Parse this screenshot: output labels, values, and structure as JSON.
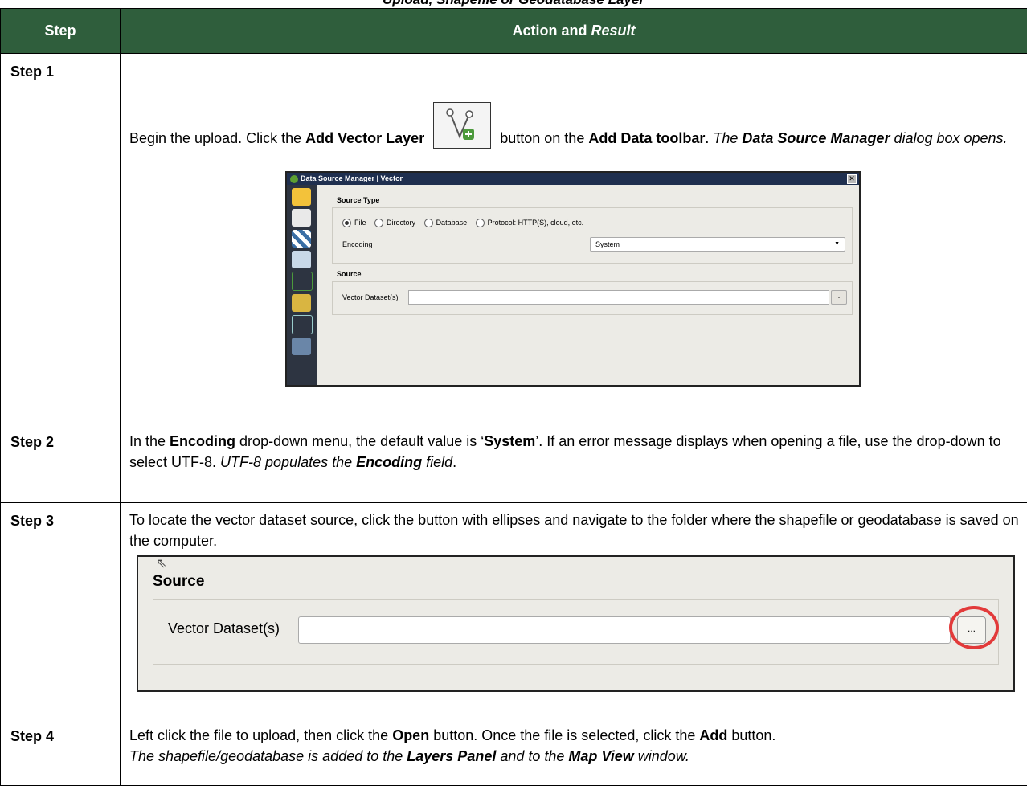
{
  "caption": "Upload, Shapefile or Geodatabase Layer",
  "table": {
    "header": {
      "step": "Step",
      "action": "Action and ",
      "result": "Result"
    },
    "rows": [
      {
        "step": "Step 1",
        "p1a": "Begin the upload. Click the ",
        "p1b": "Add Vector Layer",
        "p1c": " button on the ",
        "p1d": "Add Data toolbar",
        "p1e": ". ",
        "p1f": "The ",
        "p1g": "Data Source Manager",
        "p1h": " dialog box opens."
      },
      {
        "step": "Step 2",
        "a": "In the ",
        "b": "Encoding",
        "c": " drop-down menu, the default value is ‘",
        "d": "System",
        "e": "’. If an error message displays when opening a file, use the drop-down to select UTF-8. ",
        "f": "UTF-8 populates the ",
        "g": "Encoding",
        "h": " field",
        "i": "."
      },
      {
        "step": "Step 3",
        "text": "To locate the vector dataset source, click the button with ellipses and navigate to the folder where the shapefile or geodatabase is saved on the computer."
      },
      {
        "step": "Step 4",
        "a": "Left click the file to upload, then click the ",
        "b": "Open",
        "c": " button. Once the file is selected, click the ",
        "d": "Add",
        "e": " button.",
        "f": "The shapefile/geodatabase is added to the ",
        "g": "Layers Panel",
        "h": " and to the ",
        "i": "Map View",
        "j": " window."
      }
    ]
  },
  "dialog": {
    "title": "Data Source Manager | Vector",
    "close": "✕",
    "source_type_heading": "Source Type",
    "radios": [
      "File",
      "Directory",
      "Database",
      "Protocol: HTTP(S), cloud, etc."
    ],
    "selected_radio": "File",
    "encoding_label": "Encoding",
    "encoding_value": "System",
    "source_heading": "Source",
    "dataset_label": "Vector Dataset(s)",
    "browse": "..."
  },
  "zoom_panel": {
    "heading": "Source",
    "dataset_label": "Vector Dataset(s)",
    "browse": "..."
  },
  "colors": {
    "header_bg": "#2f5e3c",
    "highlight_ring": "#e23a3a",
    "dialog_title_bg": "#1f2f4f"
  }
}
